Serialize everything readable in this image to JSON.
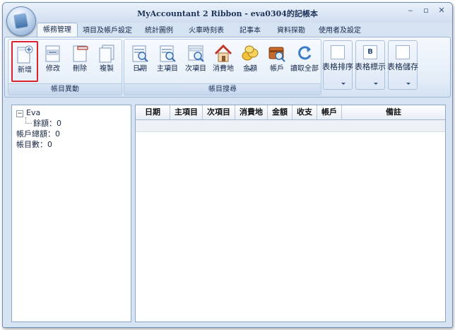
{
  "window": {
    "title": "MyAccountant 2 Ribbon - eva0304的記帳本",
    "minimize_glyph": "‒",
    "maximize_glyph": "▫",
    "close_glyph": "✕"
  },
  "tabs": [
    {
      "label": "帳務管理",
      "active": true
    },
    {
      "label": "項目及帳戶設定",
      "active": false
    },
    {
      "label": "統計圖例",
      "active": false
    },
    {
      "label": "火車時刻表",
      "active": false
    },
    {
      "label": "記事本",
      "active": false
    },
    {
      "label": "資料探勘",
      "active": false
    },
    {
      "label": "使用者及設定",
      "active": false
    }
  ],
  "ribbon": {
    "group1": {
      "label": "帳目異動",
      "buttons": [
        {
          "label": "新增",
          "icon": "new-document-icon"
        },
        {
          "label": "修改",
          "icon": "edit-document-icon"
        },
        {
          "label": "刪除",
          "icon": "delete-document-icon"
        },
        {
          "label": "複製",
          "icon": "copy-document-icon"
        }
      ]
    },
    "group2": {
      "label": "帳目搜尋",
      "buttons": [
        {
          "label": "日期",
          "icon": "calendar-search-icon",
          "dropdown": true
        },
        {
          "label": "主項目",
          "icon": "main-item-search-icon",
          "dropdown": true
        },
        {
          "label": "次項目",
          "icon": "sub-item-search-icon",
          "dropdown": true
        },
        {
          "label": "消費地",
          "icon": "house-icon",
          "dropdown": false
        },
        {
          "label": "金額",
          "icon": "coins-icon",
          "dropdown": true
        },
        {
          "label": "帳戶",
          "icon": "account-search-icon",
          "dropdown": false
        },
        {
          "label": "讀取全部",
          "icon": "refresh-icon",
          "dropdown": false
        }
      ]
    },
    "format_buttons": [
      {
        "label": "表格排序",
        "icon_text": "",
        "dropdown": true
      },
      {
        "label": "表格標示",
        "icon_text": "B",
        "dropdown": true
      },
      {
        "label": "表格儲存",
        "icon_text": "",
        "dropdown": true
      }
    ]
  },
  "tree": {
    "root": "Eva",
    "children": [
      "餘額：0",
      "帳戶總額：0",
      "帳目數：0"
    ]
  },
  "grid": {
    "columns": [
      "日期",
      "主項目",
      "次項目",
      "消費地",
      "金額",
      "收支",
      "帳戶",
      "備註"
    ]
  }
}
